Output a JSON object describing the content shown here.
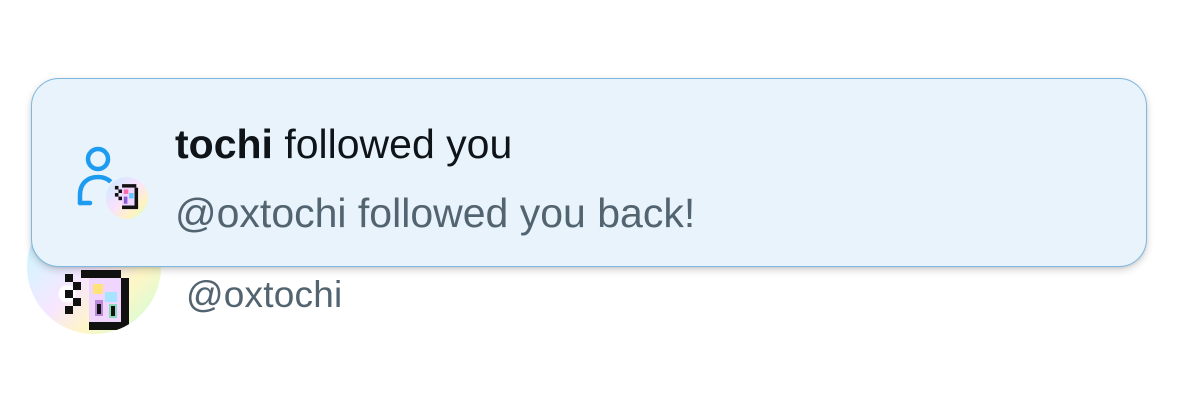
{
  "profile": {
    "handle": "@oxtochi",
    "avatar_icon": "pixel-art-avatar"
  },
  "notification": {
    "icon": "person-follow-icon",
    "user_name": "tochi",
    "action_text": "followed you",
    "message": "@oxtochi followed you back!"
  },
  "colors": {
    "toast_background": "#e8f3fc",
    "toast_border": "#7fb8e0",
    "accent_blue": "#1d9bf0",
    "primary_text": "#0f1419",
    "secondary_text": "#536471"
  }
}
